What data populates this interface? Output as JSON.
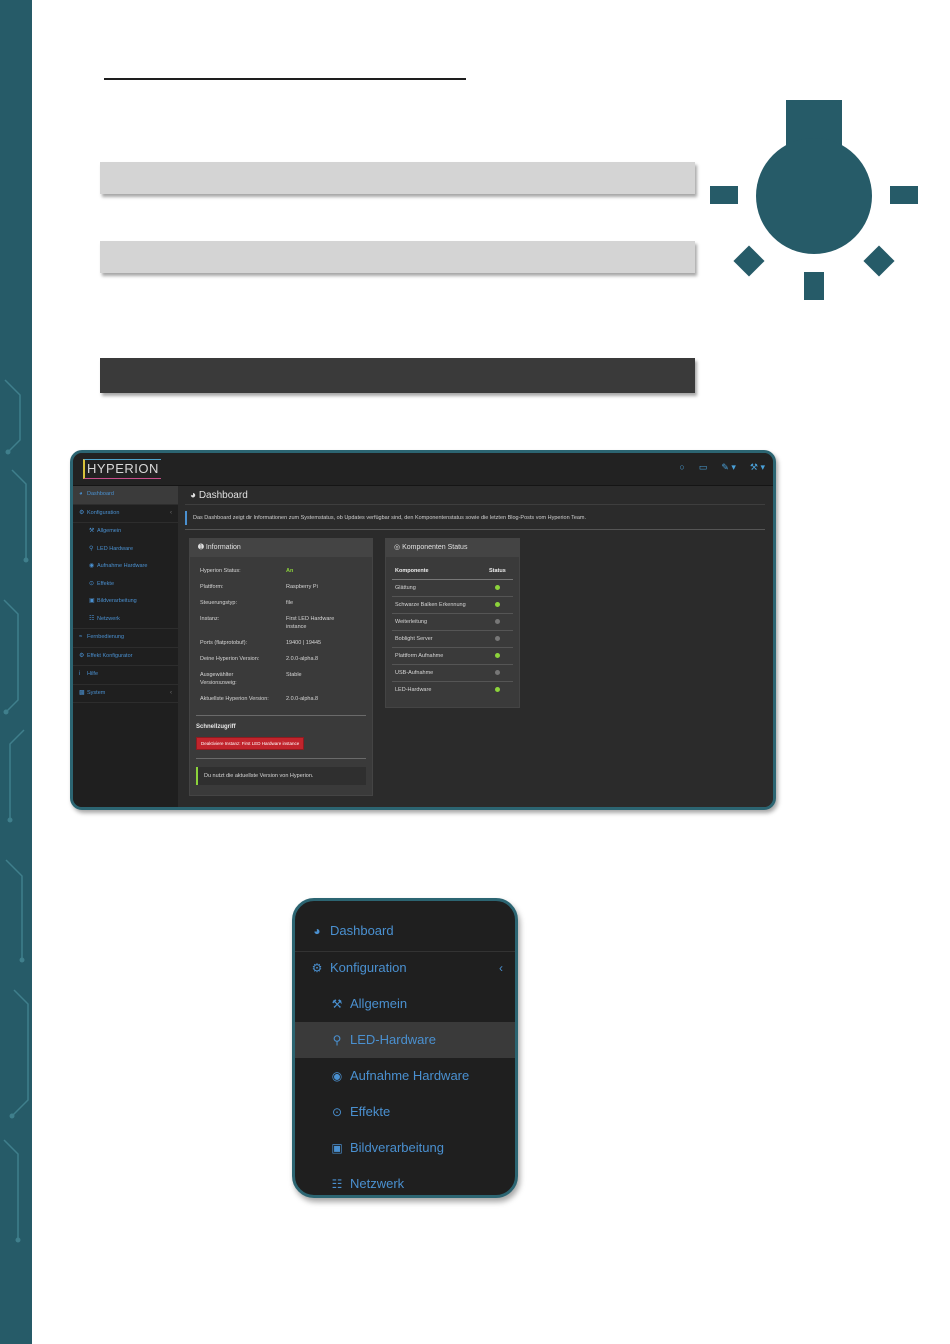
{
  "colors": {
    "teal": "#265b68",
    "panel": "#3a3a3a",
    "accent_blue": "#4a90d0",
    "green": "#8cd33b",
    "red": "#c1242c"
  },
  "app": {
    "logo_text": "HYPERION",
    "top_icons": [
      "power-icon",
      "monitor-icon",
      "brush-icon",
      "wrench-icon"
    ]
  },
  "sidebar": {
    "items": [
      {
        "label": "Dashboard",
        "icon": "dashboard-icon",
        "active": true
      },
      {
        "label": "Konfiguration",
        "icon": "gear-icon",
        "chevron": true
      },
      {
        "label": "Allgemein",
        "icon": "wrench-icon",
        "sub": true
      },
      {
        "label": "LED Hardware",
        "icon": "bulb-icon",
        "sub": true
      },
      {
        "label": "Aufnahme Hardware",
        "icon": "camera-icon",
        "sub": true
      },
      {
        "label": "Effekte",
        "icon": "spinner-icon",
        "sub": true
      },
      {
        "label": "Bildverarbeitung",
        "icon": "image-icon",
        "sub": true
      },
      {
        "label": "Netzwerk",
        "icon": "network-icon",
        "sub": true
      },
      {
        "label": "Fernbedienung",
        "icon": "wifi-icon"
      },
      {
        "label": "Effekt Konfigurator",
        "icon": "cogs-icon"
      },
      {
        "label": "Hilfe",
        "icon": "info-icon"
      },
      {
        "label": "System",
        "icon": "chart-icon",
        "chevron": true
      }
    ]
  },
  "dashboard": {
    "title": "Dashboard",
    "description": "Das Dashboard zeigt dir Informationen zum Systemstatus, ob Updates verfügbar sind, den Komponentenstatus sowie die letzten Blog-Posts vom Hyperion Team."
  },
  "information": {
    "title": "Information",
    "rows": [
      {
        "key": "Hyperion Status:",
        "value": "An"
      },
      {
        "key": "Plattform:",
        "value": "Raspberry Pi"
      },
      {
        "key": "Steuerungstyp:",
        "value": "file"
      },
      {
        "key": "Instanz:",
        "value": "First LED Hardware instance"
      },
      {
        "key": "Ports (flatprotobuf):",
        "value": "19400 | 19445"
      },
      {
        "key": "Deine Hyperion Version:",
        "value": "2.0.0-alpha.8"
      },
      {
        "key": "Ausgewählter Versionszweig:",
        "value": "Stable"
      },
      {
        "key": "Aktuellste Hyperion Version:",
        "value": "2.0.0-alpha.8"
      }
    ],
    "quick_access": "Schnellzugriff",
    "deactivate_button": "Deaktiviere Instanz: First LED Hardware instance",
    "note": "Du nutzt die aktuellste Version von Hyperion."
  },
  "components": {
    "title": "Komponenten Status",
    "header_name": "Komponente",
    "header_status": "Status",
    "rows": [
      {
        "name": "Glättung",
        "status": "on"
      },
      {
        "name": "Schwarze Balken Erkennung",
        "status": "on"
      },
      {
        "name": "Weiterleitung",
        "status": "off"
      },
      {
        "name": "Boblight Server",
        "status": "off"
      },
      {
        "name": "Plattform Aufnahme",
        "status": "on"
      },
      {
        "name": "USB-Aufnahme",
        "status": "off"
      },
      {
        "name": "LED-Hardware",
        "status": "on"
      }
    ]
  },
  "zoom": {
    "items": [
      {
        "label": "Dashboard",
        "icon": "dashboard-icon"
      },
      {
        "label": "Konfiguration",
        "icon": "gear-icon",
        "chevron": "‹"
      },
      {
        "label": "Allgemein",
        "icon": "wrench-icon"
      },
      {
        "label": "LED-Hardware",
        "icon": "bulb-icon",
        "active": true
      },
      {
        "label": "Aufnahme Hardware",
        "icon": "camera-icon"
      },
      {
        "label": "Effekte",
        "icon": "spinner-icon"
      },
      {
        "label": "Bildverarbeitung",
        "icon": "image-icon"
      },
      {
        "label": "Netzwerk",
        "icon": "network-icon"
      }
    ]
  }
}
